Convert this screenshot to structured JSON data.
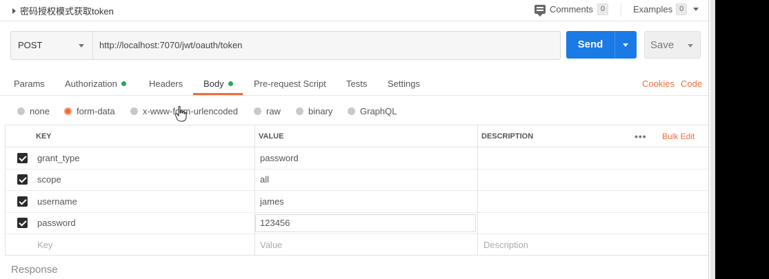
{
  "header": {
    "request_title": "密码授权模式获取token",
    "comments_label": "Comments",
    "comments_count": "0",
    "examples_label": "Examples",
    "examples_count": "0"
  },
  "request": {
    "method": "POST",
    "url": "http://localhost:7070/jwt/oauth/token",
    "send_label": "Send",
    "save_label": "Save"
  },
  "tabs": [
    {
      "label": "Params"
    },
    {
      "label": "Authorization"
    },
    {
      "label": "Headers"
    },
    {
      "label": "Body"
    },
    {
      "label": "Pre-request Script"
    },
    {
      "label": "Tests"
    },
    {
      "label": "Settings"
    }
  ],
  "tab_links": {
    "cookies": "Cookies",
    "code": "Code"
  },
  "body_types": [
    {
      "label": "none",
      "selected": false
    },
    {
      "label": "form-data",
      "selected": true
    },
    {
      "label": "x-www-form-urlencoded",
      "selected": false
    },
    {
      "label": "raw",
      "selected": false
    },
    {
      "label": "binary",
      "selected": false
    },
    {
      "label": "GraphQL",
      "selected": false
    }
  ],
  "table": {
    "columns": [
      "KEY",
      "VALUE",
      "DESCRIPTION"
    ],
    "bulk_edit": "Bulk Edit",
    "rows": [
      {
        "key": "grant_type",
        "value": "password",
        "checked": true
      },
      {
        "key": "scope",
        "value": "all",
        "checked": true
      },
      {
        "key": "username",
        "value": "james",
        "checked": true
      },
      {
        "key": "password",
        "value": "123456",
        "checked": true
      }
    ],
    "placeholders": {
      "key": "Key",
      "value": "Value",
      "description": "Description"
    }
  },
  "response_label": "Response",
  "colors": {
    "accent": "#f26b3a",
    "send": "#1a7ae6",
    "active_dot": "#2ea44f"
  }
}
